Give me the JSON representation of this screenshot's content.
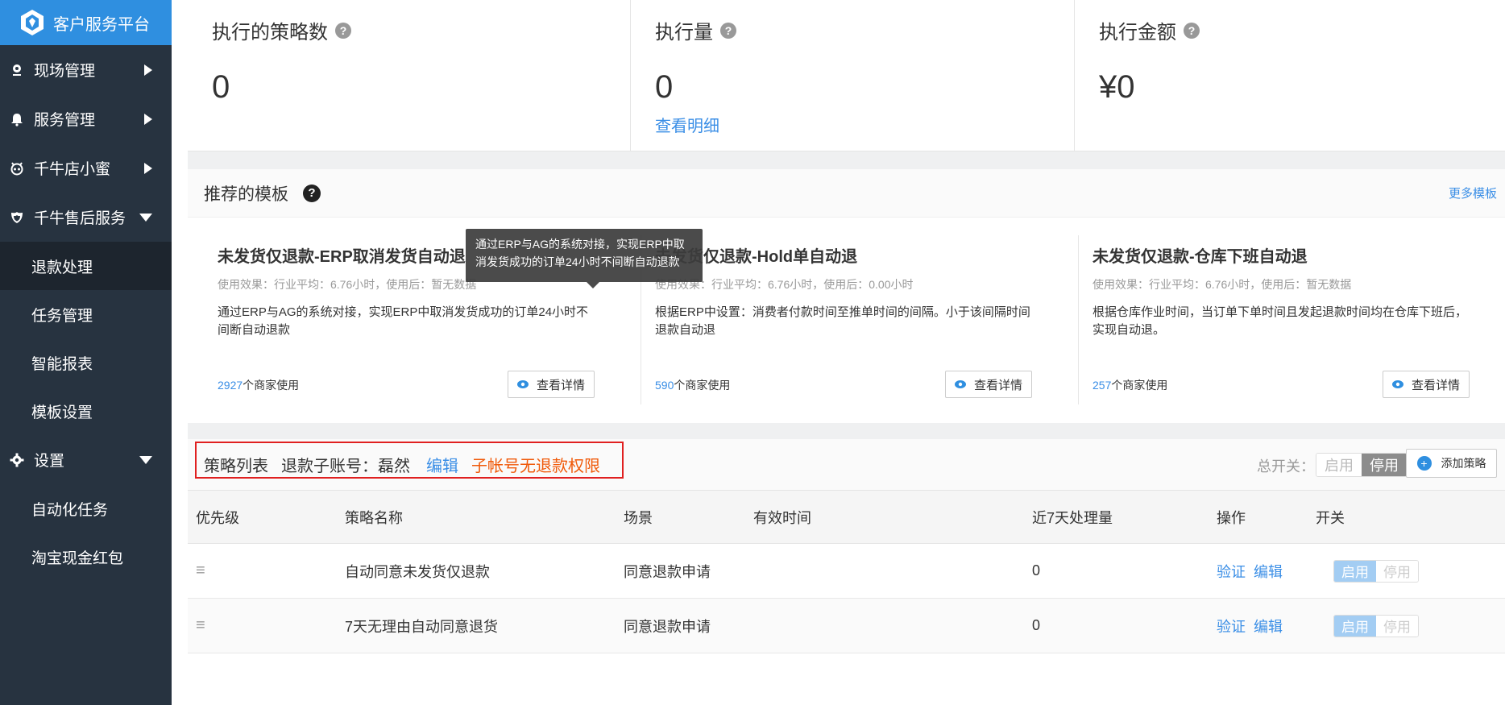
{
  "brand": {
    "title": "客户服务平台"
  },
  "sidebar": {
    "items": [
      {
        "label": "现场管理",
        "icon": "location-icon",
        "type": "group"
      },
      {
        "label": "服务管理",
        "icon": "bell-icon",
        "type": "group"
      },
      {
        "label": "千牛店小蜜",
        "icon": "robot-icon",
        "type": "group"
      },
      {
        "label": "千牛售后服务",
        "icon": "shield-icon",
        "type": "group-open"
      }
    ],
    "sub_items": [
      "退款处理",
      "任务管理",
      "智能报表",
      "模板设置"
    ],
    "settings": {
      "label": "设置",
      "icon": "gear-icon"
    },
    "settings_sub": [
      "自动化任务",
      "淘宝现金红包"
    ]
  },
  "stats": [
    {
      "title": "执行的策略数",
      "value": "0",
      "link": ""
    },
    {
      "title": "执行量",
      "value": "0",
      "link": "查看明细"
    },
    {
      "title": "执行金额",
      "value": "¥0",
      "link": ""
    }
  ],
  "templates": {
    "title": "推荐的模板",
    "more": "更多模板",
    "tooltip": "通过ERP与AG的系统对接，实现ERP中取消发货成功的订单24小时不间断自动退款",
    "detail_label": "查看详情",
    "users_suffix": "个商家使用",
    "cards": [
      {
        "name": "未发货仅退款-ERP取消发货自动退",
        "effect": "使用效果：行业平均：6.76小时，使用后：暂无数据",
        "desc": "通过ERP与AG的系统对接，实现ERP中取消发货成功的订单24小时不间断自动退款",
        "users": "2927"
      },
      {
        "name": "未发货仅退款-Hold单自动退",
        "effect": "使用效果：行业平均：6.76小时，使用后：0.00小时",
        "desc": "根据ERP中设置：消费者付款时间至推单时间的间隔。小于该间隔时间退款自动退",
        "users": "590"
      },
      {
        "name": "未发货仅退款-仓库下班自动退",
        "effect": "使用效果：行业平均：6.76小时，使用后：暂无数据",
        "desc": "根据仓库作业时间，当订单下单时间且发起退款时间均在仓库下班后，实现自动退。",
        "users": "257"
      }
    ]
  },
  "strategy": {
    "title": "策略列表",
    "account_label": "退款子账号：磊然",
    "edit": "编辑",
    "warning": "子帐号无退款权限",
    "switch_label": "总开关：",
    "enable": "启用",
    "disable": "停用",
    "add": "添加策略",
    "columns": [
      "优先级",
      "策略名称",
      "场景",
      "有效时间",
      "近7天处理量",
      "操作",
      "开关"
    ],
    "rows": [
      {
        "name": "自动同意未发货仅退款",
        "scene": "同意退款申请",
        "time": "",
        "count": "0"
      },
      {
        "name": "7天无理由自动同意退货",
        "scene": "同意退款申请",
        "time": "",
        "count": "0"
      }
    ],
    "op_verify": "验证",
    "op_edit": "编辑"
  }
}
